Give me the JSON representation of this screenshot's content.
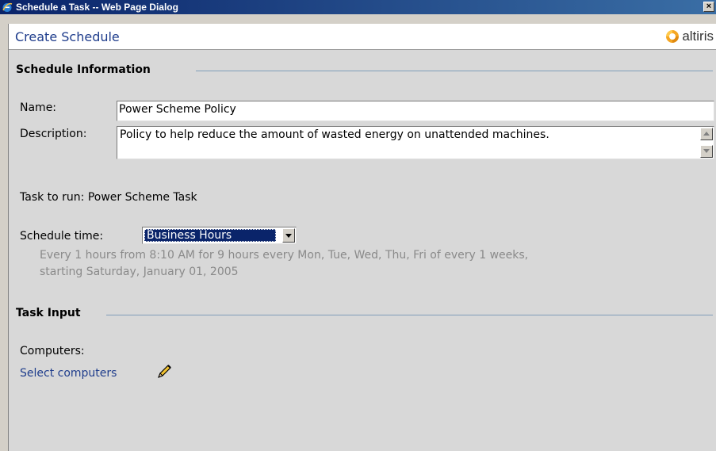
{
  "window": {
    "title": "Schedule a Task -- Web Page Dialog",
    "close_glyph": "✕"
  },
  "header": {
    "title": "Create Schedule",
    "logo_text": "altiris",
    "logo_mark": "™"
  },
  "schedule_info": {
    "heading": "Schedule Information",
    "name_label": "Name:",
    "name_value": "Power Scheme Policy",
    "description_label": "Description:",
    "description_value": "Policy to help reduce the amount of wasted energy on unattended machines.",
    "task_label": "Task to run: Power Scheme Task",
    "schedule_time_label": "Schedule time:",
    "schedule_time_value": "Business Hours",
    "schedule_line1": "Every 1 hours from 8:10 AM for 9 hours every Mon, Tue, Wed, Thu, Fri of every 1 weeks,",
    "schedule_line2": "starting Saturday, January 01, 2005"
  },
  "task_input": {
    "heading": "Task Input",
    "computers_label": "Computers:",
    "select_link": "Select computers"
  },
  "colors": {
    "titlebar": "#0a246a",
    "accent": "#1f3d8c",
    "logo_orange": "#f5a623",
    "background": "#d8d8d8"
  }
}
